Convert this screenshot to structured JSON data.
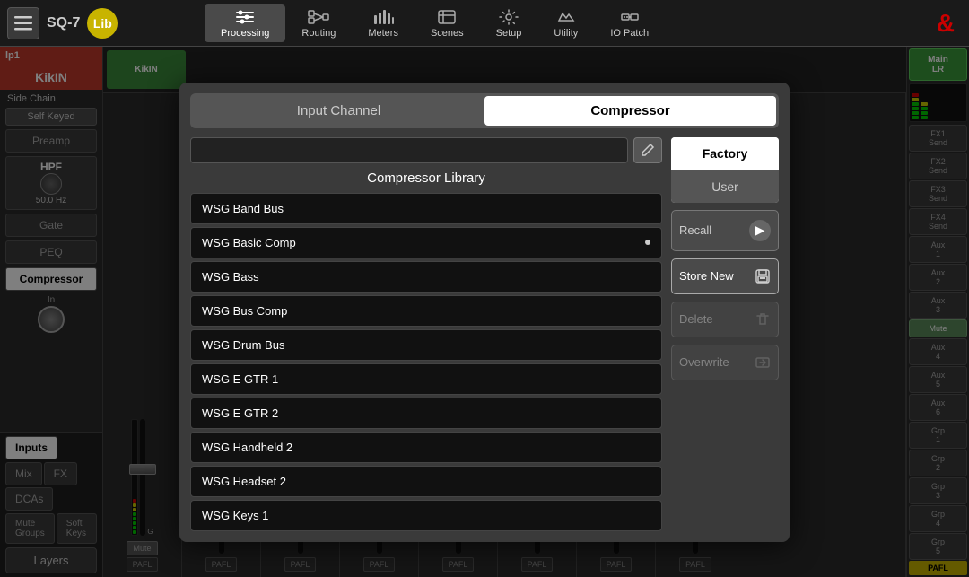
{
  "topbar": {
    "menu_icon": "≡",
    "device_name": "SQ-7",
    "lib_label": "Lib",
    "nav_items": [
      {
        "id": "processing",
        "label": "Processing",
        "active": true
      },
      {
        "id": "routing",
        "label": "Routing",
        "active": false
      },
      {
        "id": "meters",
        "label": "Meters",
        "active": false
      },
      {
        "id": "scenes",
        "label": "Scenes",
        "active": false
      },
      {
        "id": "setup",
        "label": "Setup",
        "active": false
      },
      {
        "id": "utility",
        "label": "Utility",
        "active": false
      },
      {
        "id": "iopatch",
        "label": "IO Patch",
        "active": false
      }
    ],
    "ampersand": "&"
  },
  "left_panel": {
    "channel_id": "lp1",
    "channel_name": "KikIN",
    "side_chain_label": "Side Chain",
    "self_keyed_label": "Self Keyed",
    "proc_buttons": [
      {
        "id": "preamp",
        "label": "Preamp",
        "active": false
      },
      {
        "id": "hpf",
        "label": "HPF",
        "active": false
      },
      {
        "id": "gate",
        "label": "Gate",
        "active": false
      },
      {
        "id": "peq",
        "label": "PEQ",
        "active": false
      },
      {
        "id": "compressor",
        "label": "Compressor",
        "active": true
      }
    ],
    "hpf_hz": "50.0 Hz",
    "in_label": "In"
  },
  "modal": {
    "tab_input_channel": "Input Channel",
    "tab_compressor": "Compressor",
    "active_tab": "compressor",
    "search_placeholder": "",
    "library_title": "Compressor Library",
    "items": [
      {
        "id": 1,
        "label": "WSG Band Bus",
        "selected": false,
        "dot": false
      },
      {
        "id": 2,
        "label": "WSG Basic Comp",
        "selected": false,
        "dot": true
      },
      {
        "id": 3,
        "label": "WSG Bass",
        "selected": false,
        "dot": false
      },
      {
        "id": 4,
        "label": "WSG Bus Comp",
        "selected": false,
        "dot": false
      },
      {
        "id": 5,
        "label": "WSG Drum Bus",
        "selected": false,
        "dot": false
      },
      {
        "id": 6,
        "label": "WSG E GTR 1",
        "selected": false,
        "dot": false
      },
      {
        "id": 7,
        "label": "WSG E GTR 2",
        "selected": false,
        "dot": false
      },
      {
        "id": 8,
        "label": "WSG Handheld 2",
        "selected": false,
        "dot": false
      },
      {
        "id": 9,
        "label": "WSG Headset 2",
        "selected": false,
        "dot": false
      },
      {
        "id": 10,
        "label": "WSG Keys 1",
        "selected": false,
        "dot": false
      }
    ],
    "filter": {
      "factory_label": "Factory",
      "user_label": "User",
      "active": "factory"
    },
    "recall_label": "Recall",
    "store_new_label": "Store New",
    "delete_label": "Delete",
    "overwrite_label": "Overwrite"
  },
  "bottom_nav": {
    "tabs": [
      {
        "id": "inputs",
        "label": "Inputs",
        "active": true
      },
      {
        "id": "mix",
        "label": "Mix",
        "active": false
      },
      {
        "id": "fx",
        "label": "FX",
        "active": false
      },
      {
        "id": "dcas",
        "label": "DCAs",
        "active": false
      },
      {
        "id": "mute_groups",
        "label": "Mute Groups",
        "active": false
      },
      {
        "id": "soft_keys",
        "label": "Soft Keys",
        "active": false
      }
    ],
    "layers_label": "Layers"
  },
  "channel_strips": [
    {
      "label": "KikIN",
      "pafl": "PAFL",
      "active": true
    },
    {
      "label": "",
      "pafl": "PAFL",
      "active": false
    },
    {
      "label": "",
      "pafl": "PAFL",
      "active": false
    },
    {
      "label": "",
      "pafl": "PAFL",
      "active": false
    },
    {
      "label": "",
      "pafl": "PAFL",
      "active": false
    },
    {
      "label": "",
      "pafl": "PAFL",
      "active": false
    },
    {
      "label": "",
      "pafl": "PAFL",
      "active": false
    },
    {
      "label": "",
      "pafl": "PAFL",
      "active": false
    }
  ],
  "right_sends": {
    "main_lr_label": "Main\nLR",
    "fx_sends": [
      {
        "label": "FX1\nSend"
      },
      {
        "label": "FX2\nSend"
      },
      {
        "label": "FX3\nSend"
      },
      {
        "label": "FX4\nSend"
      }
    ],
    "aux_sends": [
      {
        "label": "Aux\n1"
      },
      {
        "label": "Aux\n2"
      },
      {
        "label": "Aux\n3"
      },
      {
        "label": "Aux\n4"
      },
      {
        "label": "Aux\n5"
      },
      {
        "label": "Aux\n6"
      }
    ],
    "grp_sends": [
      {
        "label": "Grp\n1"
      },
      {
        "label": "Grp\n2"
      },
      {
        "label": "Grp\n3"
      },
      {
        "label": "Grp\n4"
      },
      {
        "label": "Grp\n5"
      }
    ],
    "mute_label": "Mute",
    "pafl_label": "PAFL"
  }
}
